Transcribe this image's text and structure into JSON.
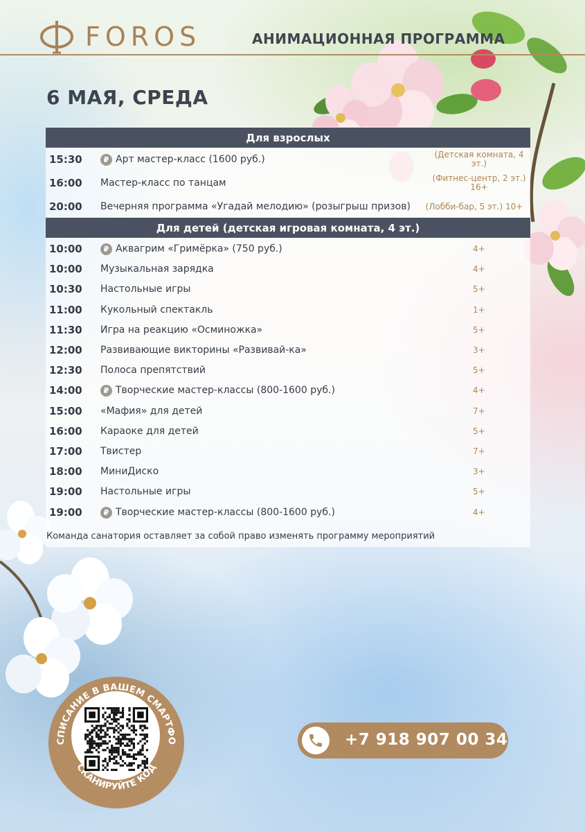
{
  "header": {
    "logo_text": "FOROS",
    "program_title": "АНИМАЦИОННАЯ ПРОГРАММА",
    "date": "6 МАЯ, СРЕДА"
  },
  "sections": [
    {
      "title": "Для взрослых",
      "rows": [
        {
          "time": "15:30",
          "name": "Арт мастер-класс (1600 руб.)",
          "paid": true,
          "place": "(Детская комната, 4 эт.)"
        },
        {
          "time": "16:00",
          "name": "Мастер-класс по танцам",
          "paid": false,
          "place": "(Фитнес-центр, 2 эт.) 16+"
        },
        {
          "time": "20:00",
          "name": "Вечерняя программа «Угадай мелодию» (розыгрыш призов)",
          "paid": false,
          "place": "(Лобби-бар, 5 эт.) 10+"
        }
      ]
    },
    {
      "title": "Для детей (детская игровая комната, 4 эт.)",
      "rows": [
        {
          "time": "10:00",
          "name": "Аквагрим «Гримёрка» (750 руб.)",
          "paid": true,
          "age": "4+"
        },
        {
          "time": "10:00",
          "name": "Музыкальная зарядка",
          "paid": false,
          "age": "4+"
        },
        {
          "time": "10:30",
          "name": "Настольные игры",
          "paid": false,
          "age": "5+"
        },
        {
          "time": "11:00",
          "name": "Кукольный спектакль",
          "paid": false,
          "age": "1+"
        },
        {
          "time": "11:30",
          "name": "Игра на реакцию «Осминожка»",
          "paid": false,
          "age": "5+"
        },
        {
          "time": "12:00",
          "name": "Развивающие викторины «Развивай-ка»",
          "paid": false,
          "age": "3+"
        },
        {
          "time": "12:30",
          "name": "Полоса препятствий",
          "paid": false,
          "age": "5+"
        },
        {
          "time": "14:00",
          "name": "Творческие мастер-классы (800-1600 руб.)",
          "paid": true,
          "age": "4+"
        },
        {
          "time": "15:00",
          "name": "«Мафия» для детей",
          "paid": false,
          "age": "7+"
        },
        {
          "time": "16:00",
          "name": "Караоке для детей",
          "paid": false,
          "age": "5+"
        },
        {
          "time": "17:00",
          "name": "Твистер",
          "paid": false,
          "age": "7+"
        },
        {
          "time": "18:00",
          "name": "МиниДиско",
          "paid": false,
          "age": "3+"
        },
        {
          "time": "19:00",
          "name": "Настольные игры",
          "paid": false,
          "age": "5+"
        },
        {
          "time": "19:00",
          "name": "Творческие мастер-классы (800-1600 руб.)",
          "paid": true,
          "age": "4+"
        }
      ]
    }
  ],
  "note": "Команда санатория оставляет за собой право изменять программу мероприятий",
  "qr": {
    "text_top": "РАСПИСАНИЕ В ВАШЕМ СМАРТФОНЕ",
    "text_bottom": "СКАНИРУЙТЕ КОД"
  },
  "phone": "+7 918 907 00 34",
  "colors": {
    "brand_gold": "#b08c62",
    "section_bar": "#4a5261",
    "text_dark": "#353b47"
  },
  "icons": {
    "ruble": "ruble-coin-icon",
    "phone": "phone-icon",
    "logo": "foros-logo-mark"
  }
}
